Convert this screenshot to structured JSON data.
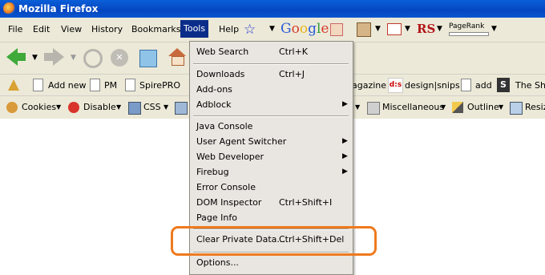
{
  "window": {
    "title": "Mozilla Firefox"
  },
  "menubar": {
    "items": [
      "File",
      "Edit",
      "View",
      "History",
      "Bookmarks",
      "Tools",
      "Help"
    ],
    "active": "Tools"
  },
  "toolbar": {
    "google_label": "Google",
    "rs_label": "RS",
    "pagerank_label": "PageRank"
  },
  "bookmarks": {
    "left_items": [
      "Add new",
      "PM",
      "SpirePRO"
    ],
    "right_items": [
      "agazine",
      "design|snips",
      "add",
      "The Sha"
    ],
    "designsnips_badge": "d:s",
    "s_badge": "S"
  },
  "devbar": {
    "left_items": [
      "Cookies",
      "Disable",
      "CSS"
    ],
    "right_items": [
      "Miscellaneous",
      "Outline",
      "Resiz"
    ]
  },
  "tools_menu": {
    "items": [
      {
        "label": "Web Search",
        "shortcut": "Ctrl+K",
        "submenu": false
      },
      {
        "label": "Downloads",
        "shortcut": "Ctrl+J",
        "submenu": false
      },
      {
        "label": "Add-ons",
        "shortcut": "",
        "submenu": false
      },
      {
        "label": "Adblock",
        "shortcut": "",
        "submenu": true
      },
      {
        "label": "Java Console",
        "shortcut": "",
        "submenu": false
      },
      {
        "label": "User Agent Switcher",
        "shortcut": "",
        "submenu": true
      },
      {
        "label": "Web Developer",
        "shortcut": "",
        "submenu": true
      },
      {
        "label": "Firebug",
        "shortcut": "",
        "submenu": true
      },
      {
        "label": "Error Console",
        "shortcut": "",
        "submenu": false
      },
      {
        "label": "DOM Inspector",
        "shortcut": "Ctrl+Shift+I",
        "submenu": false
      },
      {
        "label": "Page Info",
        "shortcut": "",
        "submenu": false
      },
      {
        "label": "Clear Private Data...",
        "shortcut": "Ctrl+Shift+Del",
        "submenu": false
      },
      {
        "label": "Options...",
        "shortcut": "",
        "submenu": false
      }
    ]
  },
  "colors": {
    "highlight": "#ee7a1e",
    "menu_active": "#0b2d8a",
    "titlebar": "#0546c0"
  }
}
